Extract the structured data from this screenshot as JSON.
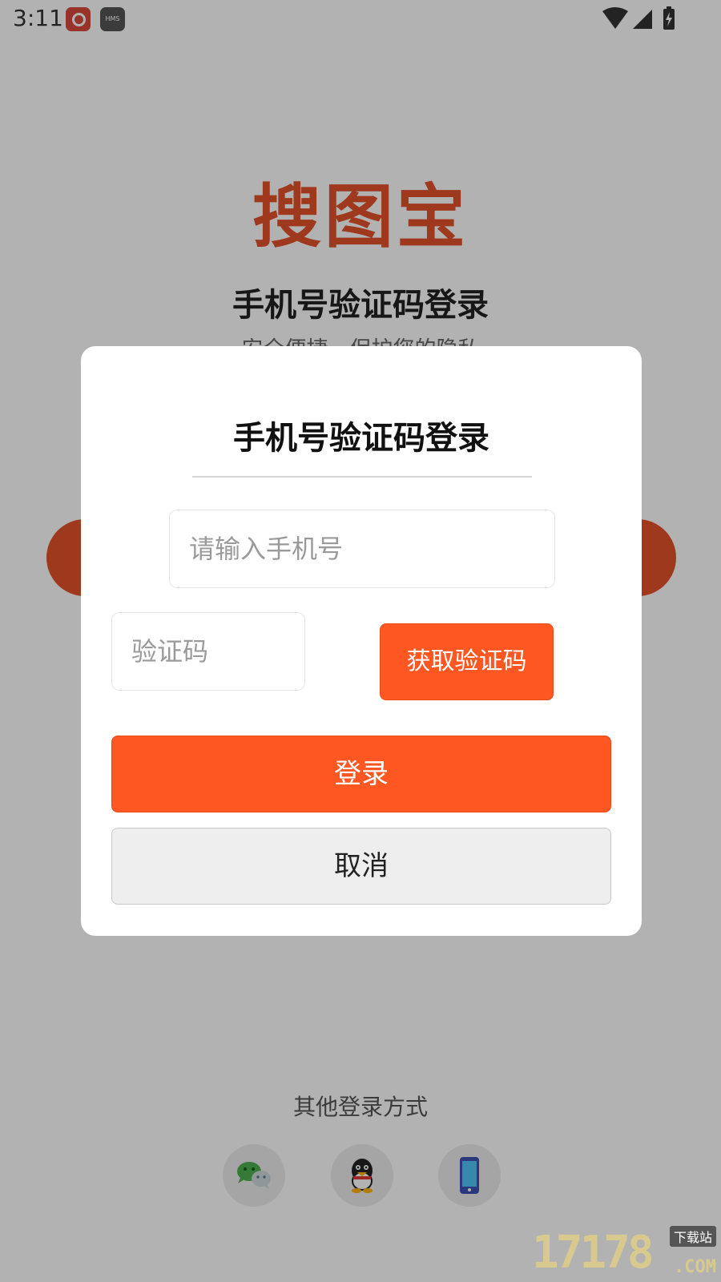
{
  "status_bar": {
    "time": "3:11",
    "notification_icons": [
      "app-icon",
      "hms-icon"
    ],
    "hms_label": "HMS",
    "system_icons": [
      "wifi-icon",
      "cell-signal-icon",
      "battery-charging-icon"
    ]
  },
  "background_page": {
    "logo": "搜图宝",
    "title": "手机号验证码登录",
    "subtitle": "安全便捷，保护您的隐私",
    "other_login_label": "其他登录方式",
    "other_login_icons": [
      "wechat-icon",
      "qq-icon",
      "mobile-phone-icon"
    ]
  },
  "dialog": {
    "title": "手机号验证码登录",
    "phone_input": {
      "value": "",
      "placeholder": "请输入手机号"
    },
    "code_input": {
      "value": "",
      "placeholder": "验证码"
    },
    "get_code_label": "获取验证码",
    "login_label": "登录",
    "cancel_label": "取消"
  },
  "watermark": {
    "digits": "17178",
    "badge": "下载站",
    "suffix": ".COM"
  },
  "colors": {
    "accent": "#ff5722",
    "brand": "#e2522b",
    "overlay": "rgba(0,0,0,0.30)",
    "cancel_bg": "#eeeeee",
    "dialog_bg": "#ffffff"
  }
}
